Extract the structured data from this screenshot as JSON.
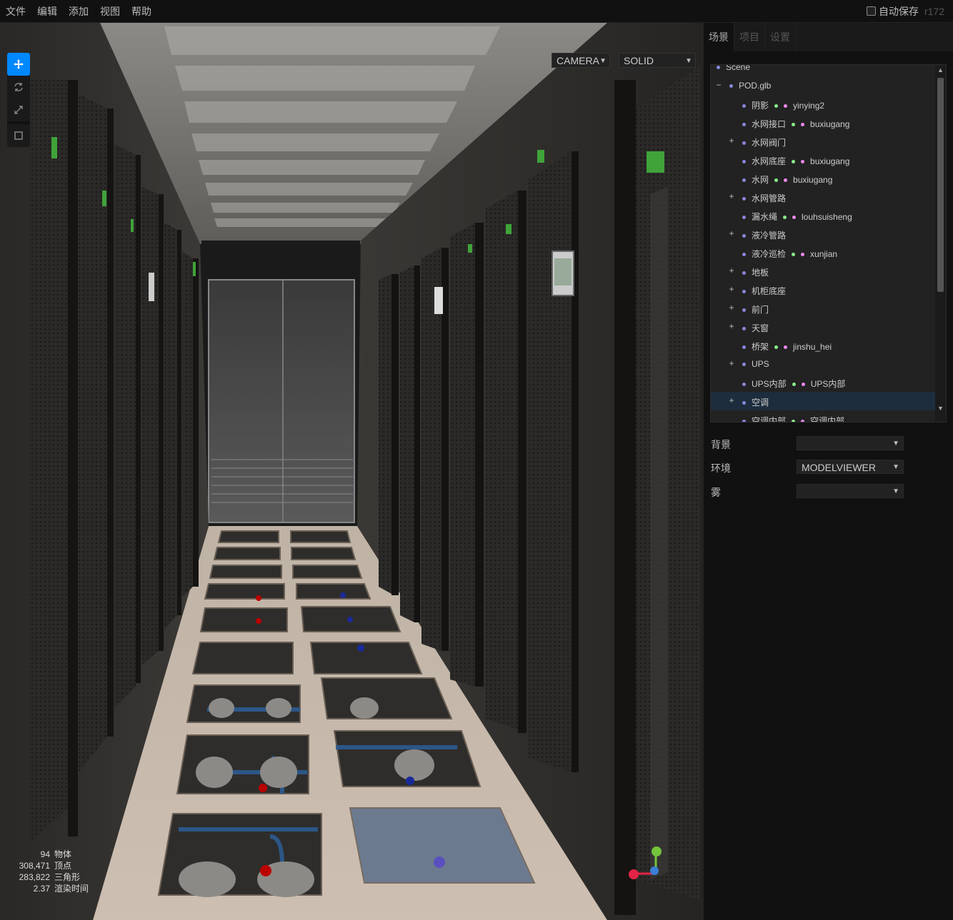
{
  "menubar": {
    "items": [
      "文件",
      "编辑",
      "添加",
      "视图",
      "帮助"
    ],
    "autosave_label": "自动保存",
    "autosave_checked": false,
    "version": "r172"
  },
  "viewport": {
    "camera_select": "CAMERA",
    "shading_select": "SOLID",
    "toolbar": [
      {
        "icon": "translate-icon",
        "selected": true
      },
      {
        "icon": "rotate-icon",
        "selected": false
      },
      {
        "icon": "scale-icon",
        "selected": false
      },
      {
        "icon": "local-space-icon",
        "selected": false
      }
    ],
    "info": {
      "objects": "94",
      "objects_label": "物体",
      "vertices": "308,471",
      "vertices_label": "顶点",
      "triangles": "283,822",
      "triangles_label": "三角形",
      "render_time": "2.37",
      "render_time_label": "渲染时间"
    },
    "axis_colors": {
      "x": "#e32446",
      "y": "#74c43c",
      "z": "#3b7fd6"
    }
  },
  "sidebar": {
    "tabs": [
      "场景",
      "项目",
      "设置"
    ],
    "active_tab": 0,
    "outliner": [
      {
        "name": "Scene",
        "depth": 0,
        "opener": ""
      },
      {
        "name": "POD.glb",
        "depth": 1,
        "opener": "−"
      },
      {
        "name": "阴影",
        "depth": 2,
        "opener": "",
        "mesh": "yinying2"
      },
      {
        "name": "水网接口",
        "depth": 2,
        "opener": "",
        "mesh": "buxiugang"
      },
      {
        "name": "水网阀门",
        "depth": 2,
        "opener": "+"
      },
      {
        "name": "水网底座",
        "depth": 2,
        "opener": "",
        "mesh": "buxiugang"
      },
      {
        "name": "水网",
        "depth": 2,
        "opener": "",
        "mesh": "buxiugang"
      },
      {
        "name": "水网管路",
        "depth": 2,
        "opener": "+"
      },
      {
        "name": "漏水绳",
        "depth": 2,
        "opener": "",
        "mesh": "louhsuisheng"
      },
      {
        "name": "液冷管路",
        "depth": 2,
        "opener": "+"
      },
      {
        "name": "液冷巡检",
        "depth": 2,
        "opener": "",
        "mesh": "xunjian"
      },
      {
        "name": "地板",
        "depth": 2,
        "opener": "+"
      },
      {
        "name": "机柜底座",
        "depth": 2,
        "opener": "+"
      },
      {
        "name": "前门",
        "depth": 2,
        "opener": "+"
      },
      {
        "name": "天窗",
        "depth": 2,
        "opener": "+"
      },
      {
        "name": "桥架",
        "depth": 2,
        "opener": "",
        "mesh": "jinshu_hei"
      },
      {
        "name": "UPS",
        "depth": 2,
        "opener": "+"
      },
      {
        "name": "UPS内部",
        "depth": 2,
        "opener": "",
        "mesh": "UPS内部"
      },
      {
        "name": "空调",
        "depth": 2,
        "opener": "+",
        "active": true
      },
      {
        "name": "空调内部",
        "depth": 2,
        "opener": "",
        "mesh": "空调内部"
      }
    ],
    "properties": {
      "background_label": "背景",
      "background_value": "",
      "environment_label": "环境",
      "environment_value": "MODELVIEWER",
      "fog_label": "雾",
      "fog_value": ""
    }
  }
}
